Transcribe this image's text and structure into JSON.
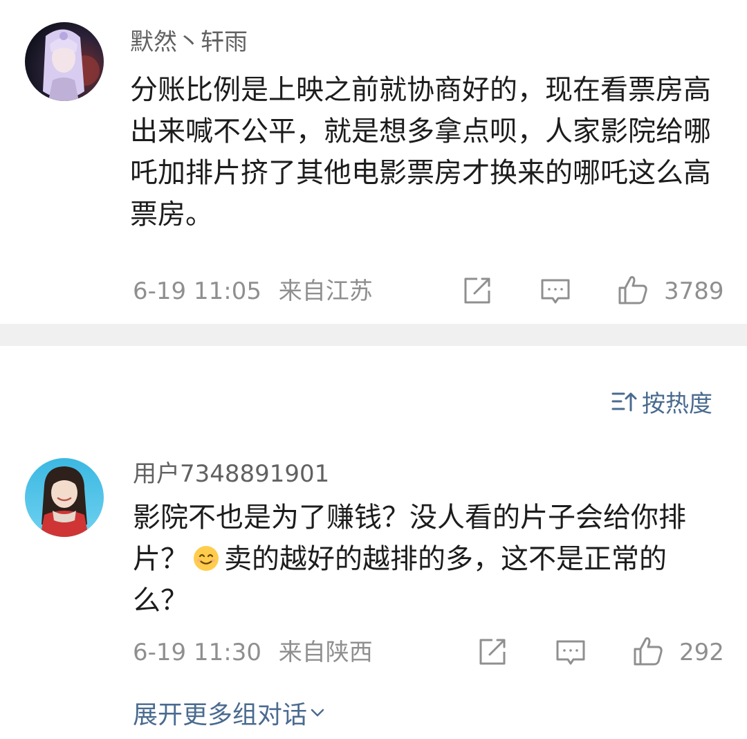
{
  "comments": [
    {
      "username": "默然丶轩雨",
      "text": "分账比例是上映之前就协商好的，现在看票房高出来喊不公平，就是想多拿点呗，人家影院给哪吒加排片挤了其他电影票房才换来的哪吒这么高票房。",
      "time": "6-19 11:05",
      "location": "来自江苏",
      "like_count": "3789",
      "avatar_colors": [
        "#2a2f4a",
        "#c9b8e6",
        "#8a3a3a"
      ]
    },
    {
      "username": "用户7348891901",
      "text_before_emoji": "影院不也是为了赚钱？没人看的片子会给你排片？",
      "emoji": "smile-emoji",
      "text_after_emoji": "卖的越好的越排的多，这不是正常的么？",
      "time": "6-19 11:30",
      "location": "来自陕西",
      "like_count": "292",
      "avatar_colors": [
        "#4fc3e8",
        "#d33b3b",
        "#3a2a24"
      ]
    }
  ],
  "sort": {
    "label": "按热度",
    "icon": "sort-icon"
  },
  "expand": {
    "label": "展开更多组对话",
    "icon": "chevron-down-icon"
  },
  "colors": {
    "link": "#4a6b8f",
    "meta": "#8f8f8f",
    "divider": "#f0f0f0"
  }
}
